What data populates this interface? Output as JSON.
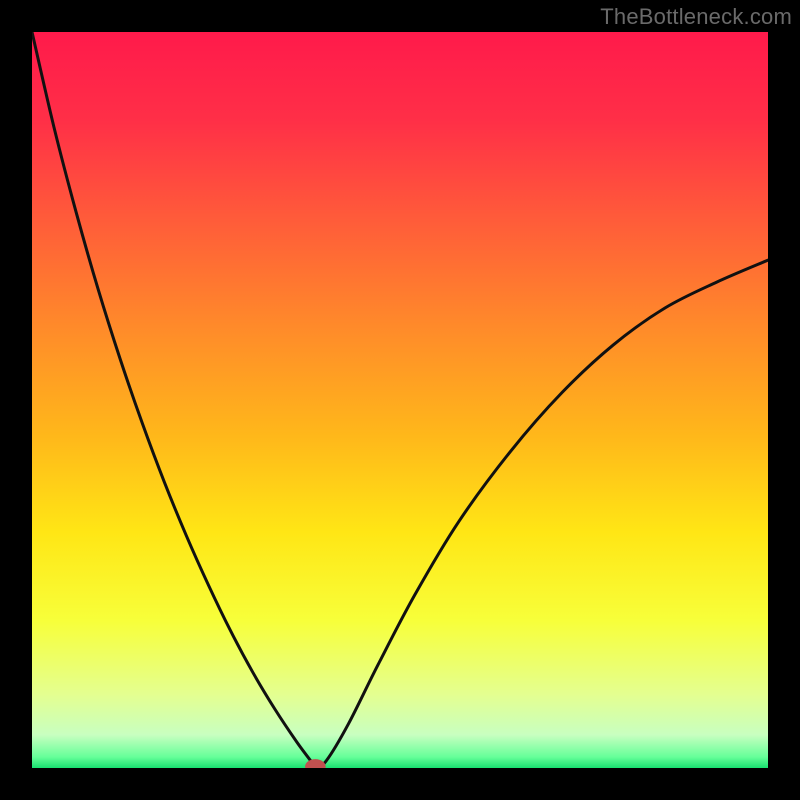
{
  "attribution": "TheBottleneck.com",
  "chart_data": {
    "type": "line",
    "title": "",
    "xlabel": "",
    "ylabel": "",
    "xlim": [
      0,
      1
    ],
    "ylim": [
      0,
      1
    ],
    "curve_min_x": 0.385,
    "x": [
      0.0,
      0.03,
      0.06,
      0.09,
      0.12,
      0.15,
      0.18,
      0.21,
      0.24,
      0.27,
      0.3,
      0.33,
      0.36,
      0.38,
      0.385,
      0.4,
      0.43,
      0.47,
      0.52,
      0.58,
      0.65,
      0.72,
      0.79,
      0.86,
      0.93,
      1.0
    ],
    "y": [
      1.0,
      0.87,
      0.755,
      0.65,
      0.555,
      0.468,
      0.388,
      0.315,
      0.248,
      0.186,
      0.13,
      0.08,
      0.035,
      0.008,
      0.0,
      0.01,
      0.06,
      0.14,
      0.235,
      0.335,
      0.43,
      0.51,
      0.575,
      0.625,
      0.66,
      0.69
    ],
    "marker": {
      "x": 0.385,
      "y": 0.002,
      "rx": 0.014,
      "ry": 0.01,
      "fill": "#c1504f"
    },
    "gradient_stops": [
      {
        "offset": 0.0,
        "color": "#ff1a4b"
      },
      {
        "offset": 0.12,
        "color": "#ff2f47"
      },
      {
        "offset": 0.25,
        "color": "#ff5a3a"
      },
      {
        "offset": 0.4,
        "color": "#ff8a2a"
      },
      {
        "offset": 0.55,
        "color": "#ffb81a"
      },
      {
        "offset": 0.68,
        "color": "#ffe615"
      },
      {
        "offset": 0.8,
        "color": "#f7ff3a"
      },
      {
        "offset": 0.9,
        "color": "#e4ff90"
      },
      {
        "offset": 0.955,
        "color": "#c8ffc0"
      },
      {
        "offset": 0.985,
        "color": "#66ff99"
      },
      {
        "offset": 1.0,
        "color": "#18e070"
      }
    ],
    "curve_stroke": "#111111",
    "curve_width": 3
  }
}
